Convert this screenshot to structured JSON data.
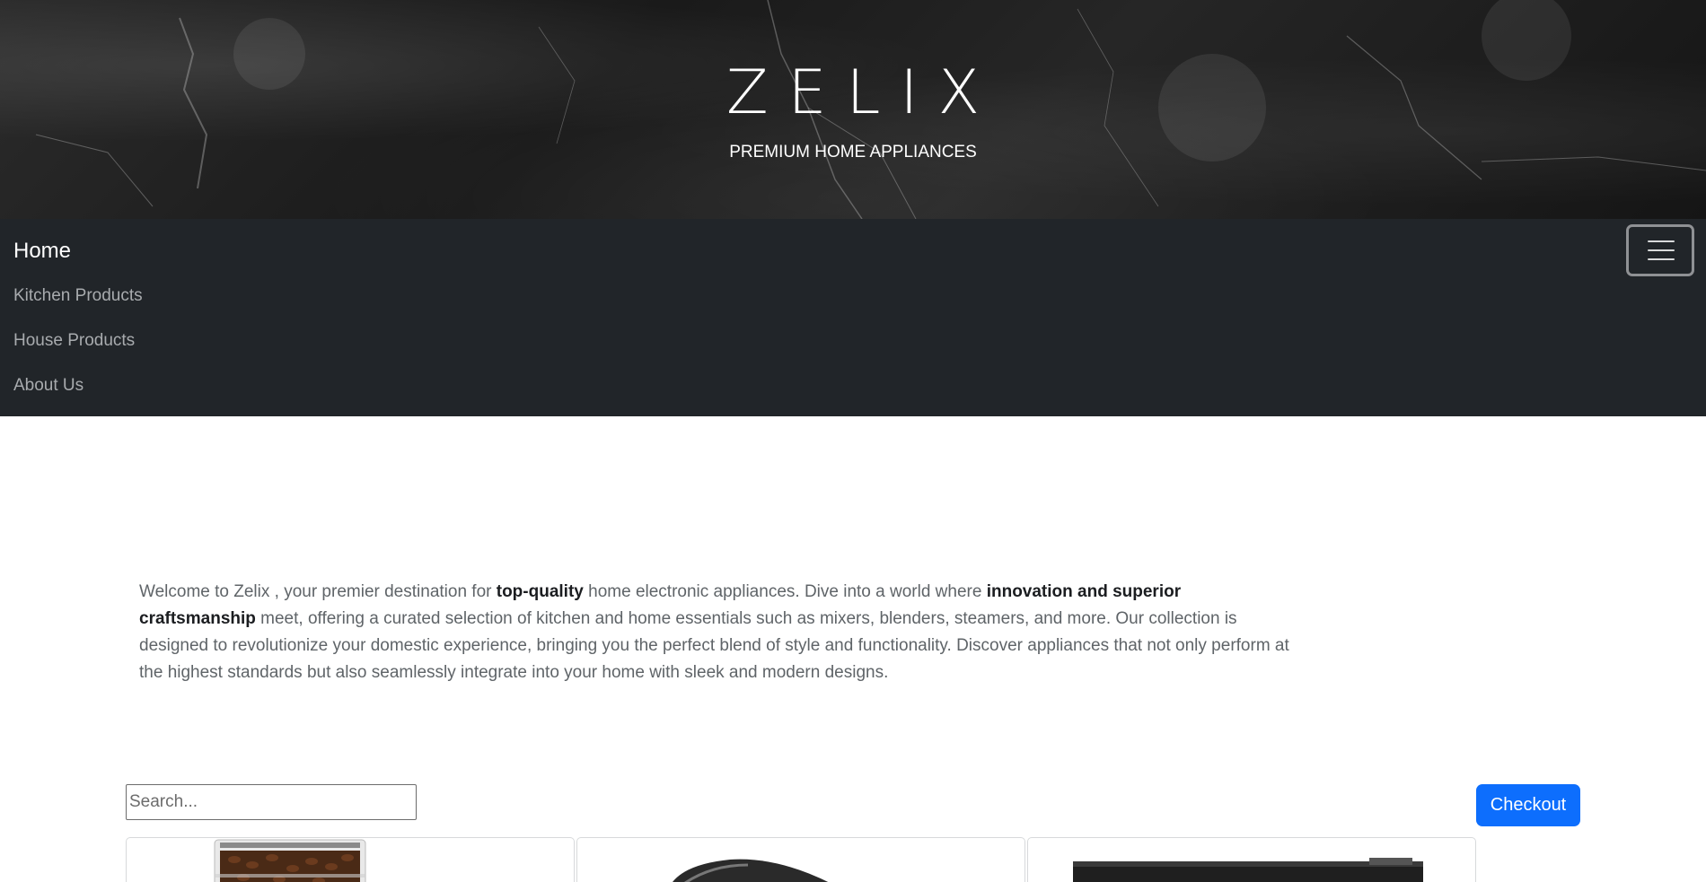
{
  "header": {
    "brand": "ZELIX",
    "tagline": "PREMIUM HOME APPLIANCES"
  },
  "nav": {
    "home": "Home",
    "items": [
      {
        "label": "Kitchen Products"
      },
      {
        "label": "House Products"
      },
      {
        "label": "About Us"
      }
    ],
    "toggler_icon": "hamburger-menu-icon"
  },
  "intro": {
    "p1": "Welcome to Zelix , your premier destination for ",
    "b1": "top-quality",
    "p2": " home electronic appliances. Dive into a world where ",
    "b2": "innovation and superior craftsmanship",
    "p3": " meet, offering a curated selection of kitchen and home essentials such as mixers, blenders, steamers, and more. Our collection is designed to revolutionize your domestic experience, bringing you the perfect blend of style and functionality. Discover appliances that not only perform at the highest standards but also seamlessly integrate into your home with sleek and modern designs."
  },
  "toolbar": {
    "search_placeholder": "Search...",
    "search_value": "",
    "checkout_label": "Checkout"
  },
  "colors": {
    "navbar_bg": "#212529",
    "accent": "#0d6efd"
  },
  "products": [
    {
      "image": "coffee-bean-container-image"
    },
    {
      "image": "dark-appliance-image"
    },
    {
      "image": "black-oven-image"
    }
  ]
}
